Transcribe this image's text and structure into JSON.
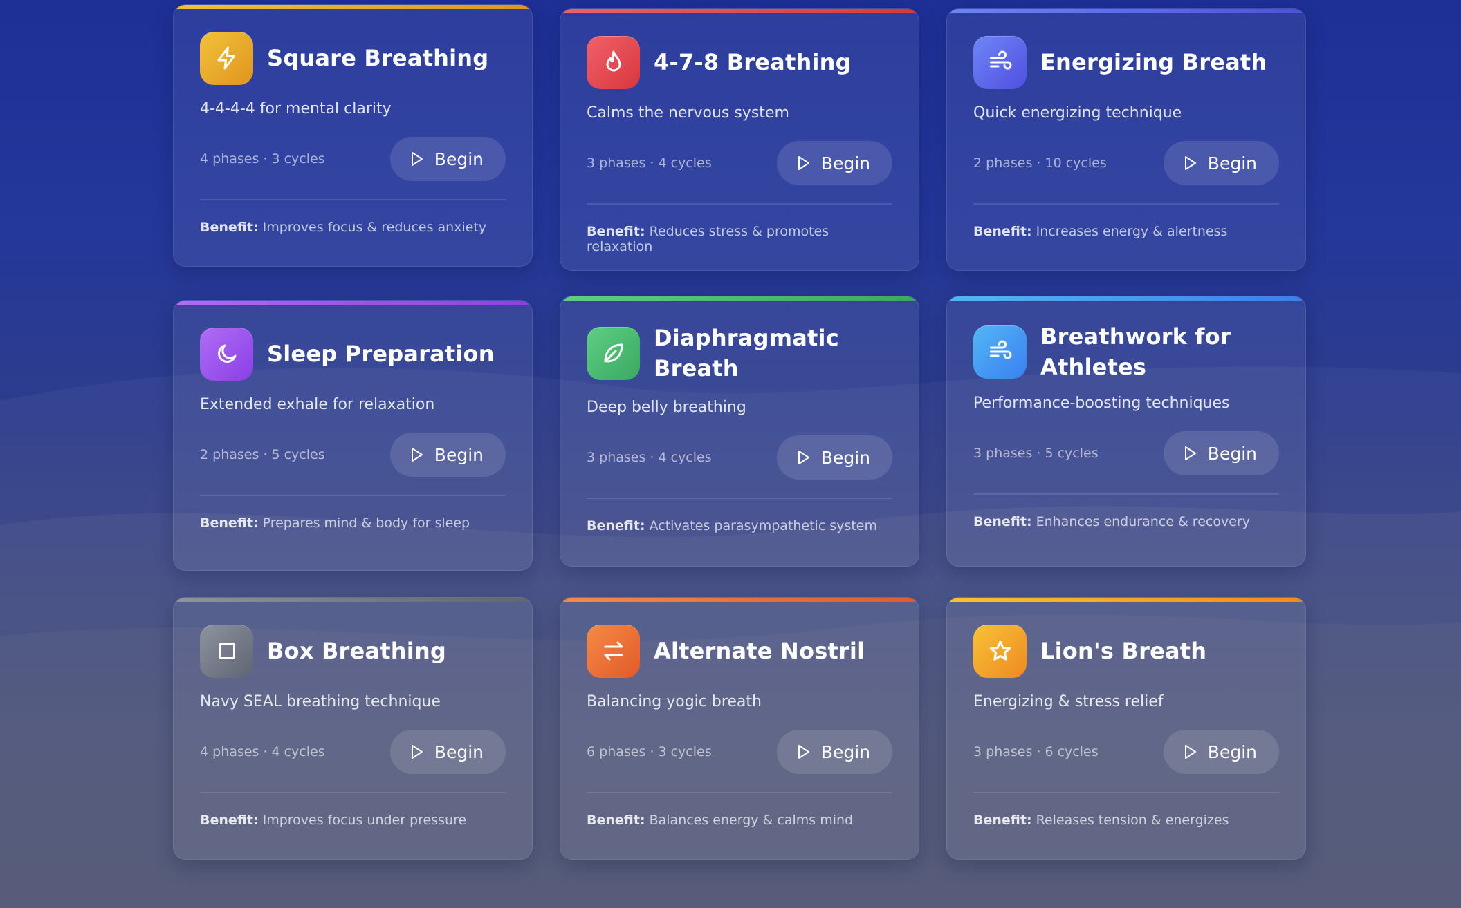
{
  "cards": [
    {
      "title": "Square Breathing",
      "description": "4-4-4-4 for mental clarity",
      "meta": "4 phases · 3 cycles",
      "begin_label": "Begin",
      "benefit_label": "Benefit:",
      "benefit": "Improves focus & reduces anxiety",
      "icon": "lightning-icon",
      "color_from": "#f2c23a",
      "color_to": "#e0951d"
    },
    {
      "title": "4-7-8 Breathing",
      "description": "Calms the nervous system",
      "meta": "3 phases · 4 cycles",
      "begin_label": "Begin",
      "benefit_label": "Benefit:",
      "benefit": "Reduces stress & promotes relaxation",
      "icon": "flame-icon",
      "color_from": "#f0616a",
      "color_to": "#d9373c"
    },
    {
      "title": "Energizing Breath",
      "description": "Quick energizing technique",
      "meta": "2 phases · 10 cycles",
      "begin_label": "Begin",
      "benefit_label": "Benefit:",
      "benefit": "Increases energy & alertness",
      "icon": "wind-icon",
      "color_from": "#6f86f6",
      "color_to": "#4f4fe0"
    },
    {
      "title": "Sleep Preparation",
      "description": "Extended exhale for relaxation",
      "meta": "2 phases · 5 cycles",
      "begin_label": "Begin",
      "benefit_label": "Benefit:",
      "benefit": "Prepares mind & body for sleep",
      "icon": "moon-icon",
      "color_from": "#b06df5",
      "color_to": "#8a3fe6"
    },
    {
      "title": "Diaphragmatic Breath",
      "description": "Deep belly breathing",
      "meta": "3 phases · 4 cycles",
      "begin_label": "Begin",
      "benefit_label": "Benefit:",
      "benefit": "Activates parasympathetic system",
      "icon": "leaf-icon",
      "color_from": "#5fcf86",
      "color_to": "#3aa95f"
    },
    {
      "title": "Breathwork for Athletes",
      "description": "Performance-boosting techniques",
      "meta": "3 phases · 5 cycles",
      "begin_label": "Begin",
      "benefit_label": "Benefit:",
      "benefit": "Enhances endurance & recovery",
      "icon": "wind-icon",
      "color_from": "#52b7f5",
      "color_to": "#3a7ff0"
    },
    {
      "title": "Box Breathing",
      "description": "Navy SEAL breathing technique",
      "meta": "4 phases · 4 cycles",
      "begin_label": "Begin",
      "benefit_label": "Benefit:",
      "benefit": "Improves focus under pressure",
      "icon": "square-icon",
      "color_from": "#8e939f",
      "color_to": "#5f6473"
    },
    {
      "title": "Alternate Nostril",
      "description": "Balancing yogic breath",
      "meta": "6 phases · 3 cycles",
      "begin_label": "Begin",
      "benefit_label": "Benefit:",
      "benefit": "Balances energy & calms mind",
      "icon": "arrows-swap-icon",
      "color_from": "#f58a45",
      "color_to": "#e25a29"
    },
    {
      "title": "Lion's Breath",
      "description": "Energizing & stress relief",
      "meta": "3 phases · 6 cycles",
      "begin_label": "Begin",
      "benefit_label": "Benefit:",
      "benefit": "Releases tension & energizes",
      "icon": "star-icon",
      "color_from": "#f8c236",
      "color_to": "#ef8a22"
    }
  ]
}
